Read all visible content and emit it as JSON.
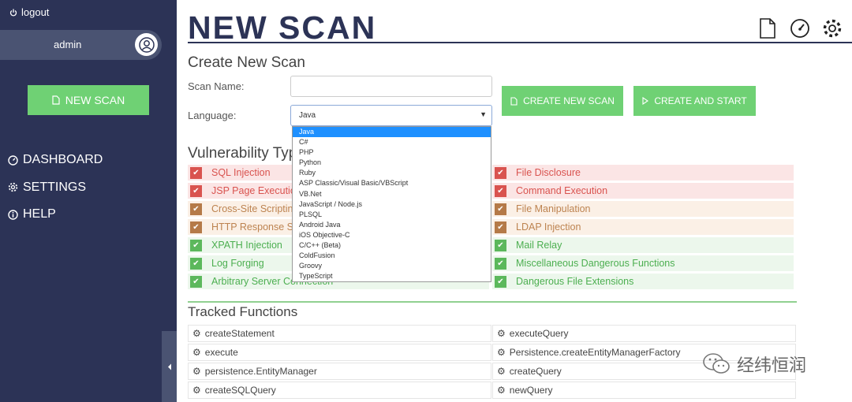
{
  "sidebar": {
    "logout_label": "logout",
    "username": "admin",
    "new_scan_label": "NEW SCAN",
    "nav": [
      {
        "label": "DASHBOARD",
        "icon": "dashboard-icon"
      },
      {
        "label": "SETTINGS",
        "icon": "gear-icon"
      },
      {
        "label": "HELP",
        "icon": "info-icon"
      }
    ]
  },
  "header": {
    "title": "NEW SCAN",
    "icons": [
      "document-icon",
      "speedometer-icon",
      "gear-icon"
    ]
  },
  "form": {
    "section_title": "Create New Scan",
    "scan_name_label": "Scan Name:",
    "scan_name_value": "",
    "language_label": "Language:",
    "language_selected": "Java",
    "create_button": "CREATE NEW SCAN",
    "create_start_button": "CREATE AND START"
  },
  "language_options": [
    "Java",
    "C#",
    "PHP",
    "Python",
    "Ruby",
    "ASP Classic/Visual Basic/VBScript",
    "VB.Net",
    "JavaScript / Node.js",
    "PLSQL",
    "Android Java",
    "iOS Objective-C",
    "C/C++ (Beta)",
    "ColdFusion",
    "Groovy",
    "TypeScript"
  ],
  "vulnerabilities": {
    "title": "Vulnerability Types",
    "left": [
      {
        "label": "SQL Injection",
        "severity": "red"
      },
      {
        "label": "JSP Page Execution",
        "severity": "red"
      },
      {
        "label": "Cross-Site Scripting",
        "severity": "orange"
      },
      {
        "label": "HTTP Response Spl",
        "severity": "orange"
      },
      {
        "label": "XPATH Injection",
        "severity": "green"
      },
      {
        "label": "Log Forging",
        "severity": "green"
      },
      {
        "label": "Arbitrary Server Connection",
        "severity": "green"
      }
    ],
    "right": [
      {
        "label": "File Disclosure",
        "severity": "red"
      },
      {
        "label": "Command Execution",
        "severity": "red"
      },
      {
        "label": "File Manipulation",
        "severity": "orange"
      },
      {
        "label": "LDAP Injection",
        "severity": "orange"
      },
      {
        "label": "Mail Relay",
        "severity": "green"
      },
      {
        "label": "Miscellaneous Dangerous Functions",
        "severity": "green"
      },
      {
        "label": "Dangerous File Extensions",
        "severity": "green"
      }
    ]
  },
  "tracked": {
    "title": "Tracked Functions",
    "left": [
      "createStatement",
      "execute",
      "persistence.EntityManager",
      "createSQLQuery"
    ],
    "right": [
      "executeQuery",
      "Persistence.createEntityManagerFactory",
      "createQuery",
      "newQuery"
    ]
  },
  "watermark": "经纬恒润",
  "colors": {
    "sidebar": "#2c3356",
    "accent_green": "#6fd174",
    "severity_red": "#d9534f",
    "severity_orange": "#b57a48",
    "severity_green": "#5cb85c"
  }
}
